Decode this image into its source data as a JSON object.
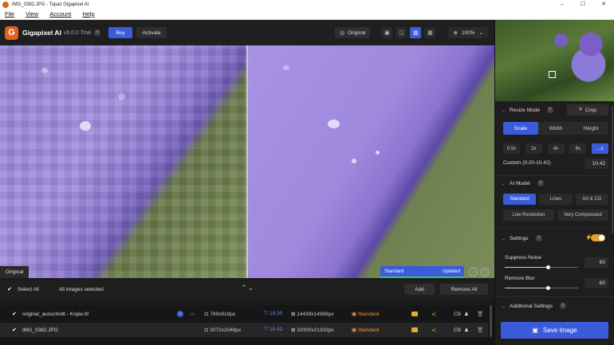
{
  "window": {
    "title": "IMG_0382.JPG - Topaz Gigapixel AI",
    "minimize": "–",
    "maximize": "☐",
    "close": "✕"
  },
  "menu": [
    "File",
    "View",
    "Account",
    "Help"
  ],
  "header": {
    "brand": "Gigapixel AI",
    "version": "v6.0.0 Trial",
    "help": "?",
    "buy_label": "Buy",
    "activate_label": "Activate",
    "original_label": "Original",
    "zoom": "100%"
  },
  "viewer": {
    "left_label": "Original",
    "status_model": "Standard",
    "status_state": "Updated"
  },
  "list": {
    "select_all": "Select All",
    "selected_text": "All images selected",
    "add_label": "Add",
    "remove_all_label": "Remove All",
    "files": [
      {
        "name": "original_ausschnitt - Kopie.tif",
        "src": "789x818px",
        "scale": "18.30",
        "dst": "14439x14969px",
        "model": "Standard",
        "cb": "CB"
      },
      {
        "name": "IMG_0382.JPG",
        "src": "3072x2048px",
        "scale": "10.42",
        "dst": "32000x21333px",
        "model": "Standard",
        "cb": "CB"
      }
    ]
  },
  "panel": {
    "resize_mode": "Resize Mode",
    "crop_label": "Crop",
    "modes": [
      "Scale",
      "Width",
      "Height"
    ],
    "scales": [
      "0.5x",
      "2x",
      "4x",
      "6x",
      "...x"
    ],
    "custom_label": "Custom (0.20-10.42)",
    "custom_value": "10.42",
    "ai_model": "AI Model",
    "models_row1": [
      "Standard",
      "Lines",
      "Art & CG"
    ],
    "models_row2": [
      "Low Resolution",
      "Very Compressed"
    ],
    "settings": "Settings",
    "suppress_noise": "Suppress Noise",
    "suppress_noise_value": "60",
    "remove_blur": "Remove Blur",
    "remove_blur_value": "60",
    "additional_settings": "Additional Settings",
    "save_label": "Save Image"
  },
  "colors": {
    "accent": "#3b5bdb",
    "brand": "#e0621a",
    "warning": "#e0a03a",
    "success": "#3ec16b"
  }
}
